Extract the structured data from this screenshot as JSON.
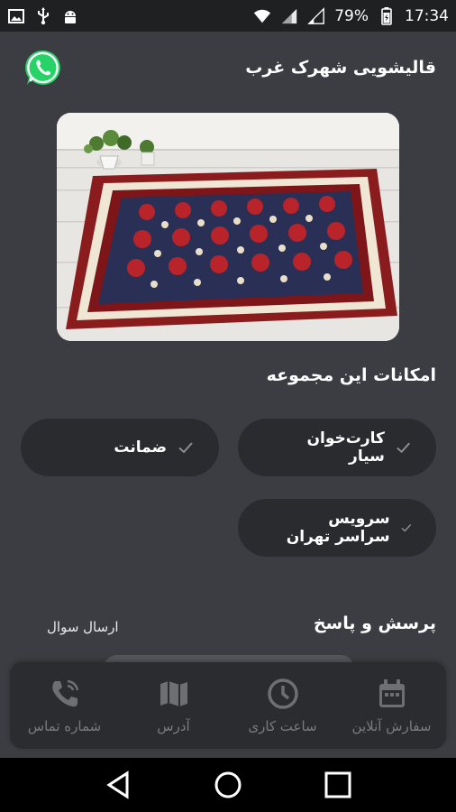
{
  "status_bar": {
    "battery_percent": "79%",
    "time": "17:34"
  },
  "header": {
    "title": "قالیشویی شهرک غرب"
  },
  "features": {
    "title": "امکانات این مجموعه",
    "items": [
      {
        "label": "کارت‌خوان سیار"
      },
      {
        "label": "ضمانت"
      },
      {
        "label": "سرویس سراسر تهران"
      }
    ]
  },
  "qa": {
    "title": "پرسش و پاسخ",
    "ask_label": "ارسال سوال"
  },
  "bottom_nav": {
    "items": [
      {
        "label": "شماره تماس",
        "icon": "phone-icon"
      },
      {
        "label": "آدرس",
        "icon": "map-icon"
      },
      {
        "label": "ساعت کاری",
        "icon": "clock-icon"
      },
      {
        "label": "سفارش آنلاین",
        "icon": "calendar-icon"
      }
    ]
  },
  "colors": {
    "background": "#3c3d42",
    "card": "#2a2b2e",
    "whatsapp": "#25d366"
  }
}
